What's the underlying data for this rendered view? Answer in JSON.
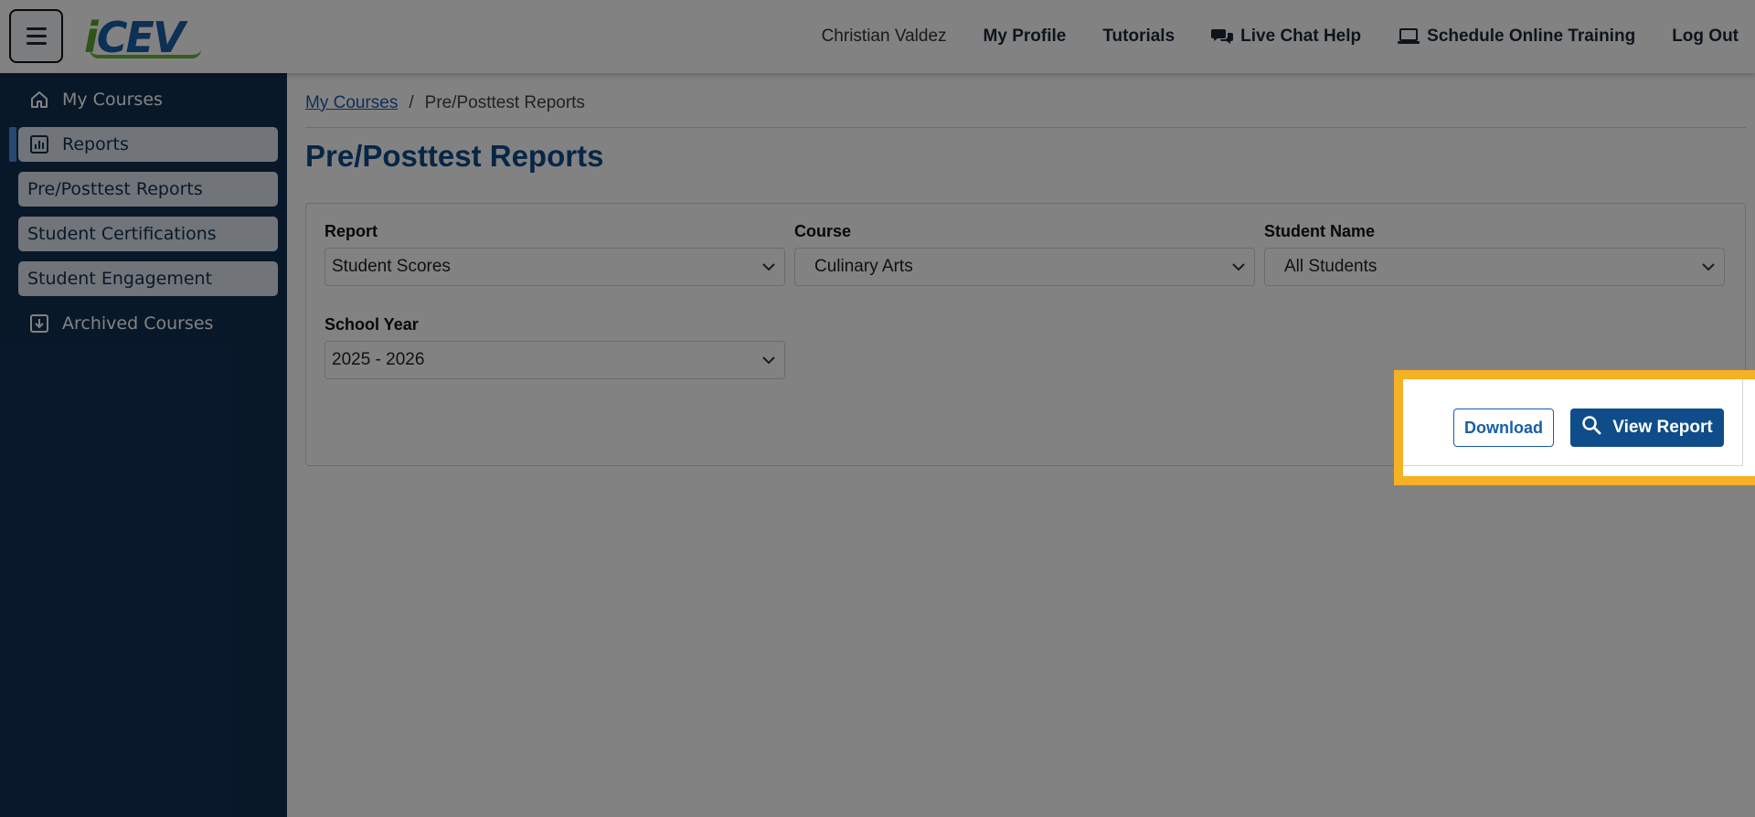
{
  "header": {
    "logo_text": "iCEV",
    "user_name": "Christian Valdez",
    "nav": {
      "my_profile": "My Profile",
      "tutorials": "Tutorials",
      "live_chat": "Live Chat Help",
      "schedule_training": "Schedule Online Training",
      "log_out": "Log Out"
    }
  },
  "sidebar": {
    "items": [
      {
        "label": "My Courses",
        "icon": "home-icon"
      },
      {
        "label": "Reports",
        "icon": "chart-icon",
        "active": true
      },
      {
        "label": "Pre/Posttest Reports"
      },
      {
        "label": "Student Certifications"
      },
      {
        "label": "Student Engagement"
      },
      {
        "label": "Archived Courses",
        "icon": "archive-icon"
      }
    ]
  },
  "breadcrumb": {
    "home": "My Courses",
    "separator": "/",
    "current": "Pre/Posttest Reports"
  },
  "page_title": "Pre/Posttest Reports",
  "filters": {
    "report": {
      "label": "Report",
      "value": "Student Scores"
    },
    "course": {
      "label": "Course",
      "value": "Culinary Arts"
    },
    "student": {
      "label": "Student Name",
      "value": "All Students"
    },
    "school_year": {
      "label": "School Year",
      "value": "2025 - 2026"
    }
  },
  "actions": {
    "download": "Download",
    "view_report": "View Report"
  },
  "colors": {
    "primary": "#0f4c8a",
    "sidebar_bg": "#123052",
    "highlight": "#f7b124",
    "logo_green": "#5aa532"
  }
}
